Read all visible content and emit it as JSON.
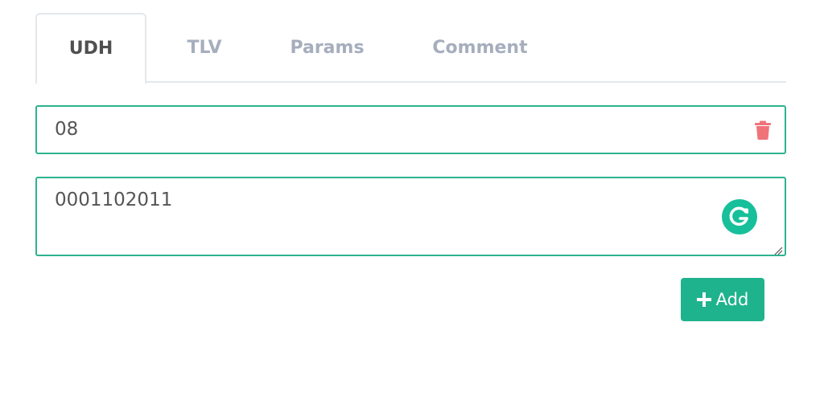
{
  "tabs": [
    {
      "label": "UDH",
      "active": true
    },
    {
      "label": "TLV",
      "active": false
    },
    {
      "label": "Params",
      "active": false
    },
    {
      "label": "Comment",
      "active": false
    }
  ],
  "udh": {
    "key_value": "08",
    "value_text": "0001102011"
  },
  "actions": {
    "add_label": "Add"
  },
  "icons": {
    "delete": "trash-icon",
    "grammarly": "grammarly-badge-icon",
    "add": "plus-icon"
  },
  "colors": {
    "accent": "#1fb38d",
    "field_border": "#2db38f",
    "trash": "#f0737a",
    "tab_inactive": "#a6aebd",
    "tab_active": "#4f4f4f"
  }
}
